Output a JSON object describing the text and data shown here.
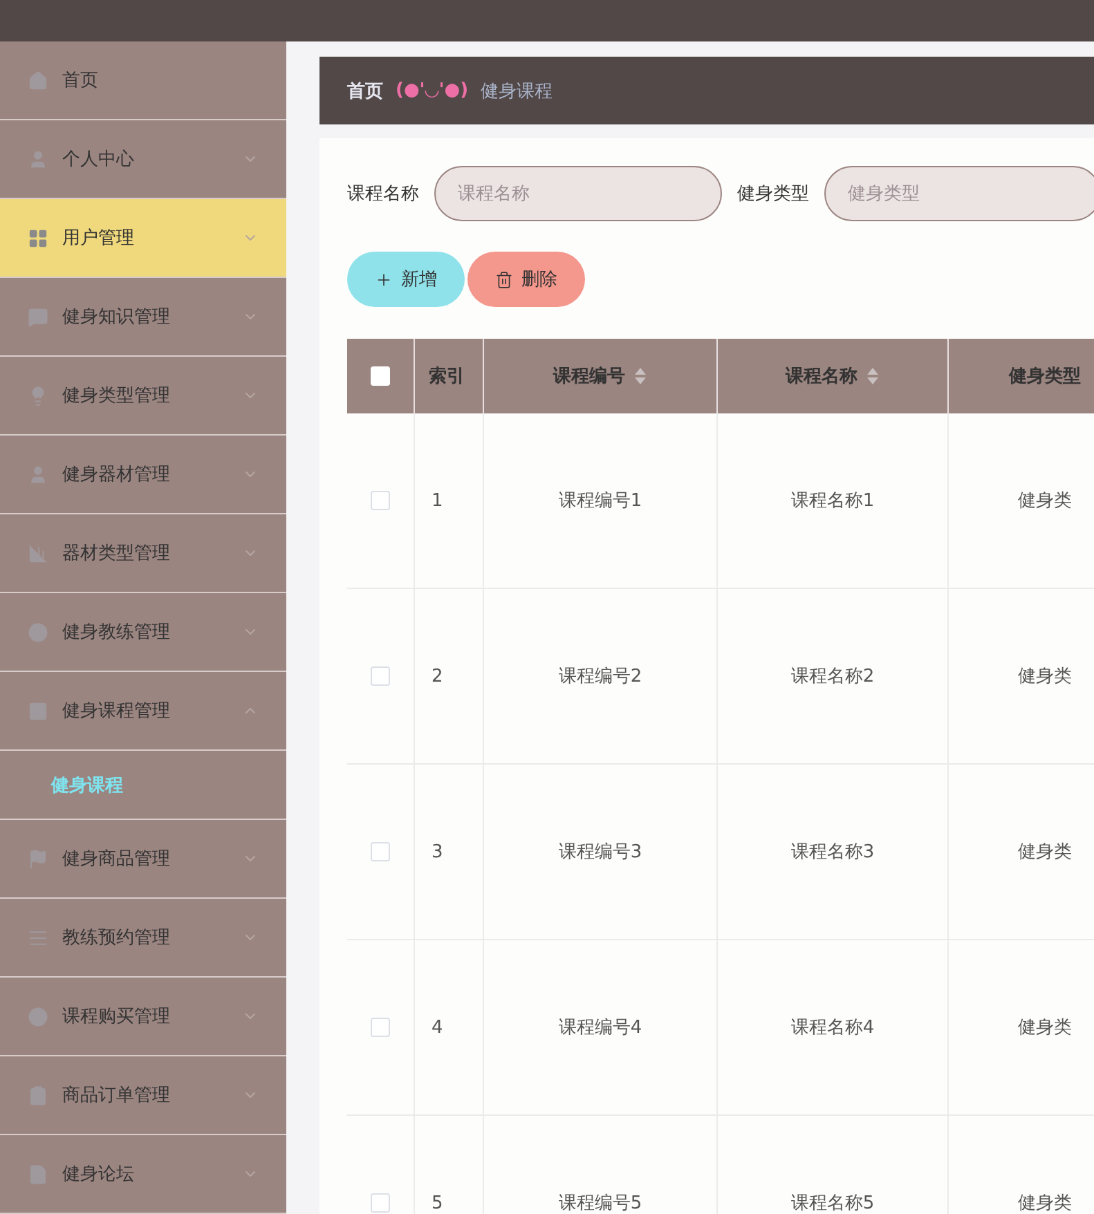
{
  "sidebar": {
    "items": [
      {
        "label": "首页",
        "kind": "link",
        "highlighted": false
      },
      {
        "label": "个人中心",
        "kind": "menu",
        "expanded": false,
        "highlighted": false
      },
      {
        "label": "用户管理",
        "kind": "menu",
        "expanded": false,
        "highlighted": true
      },
      {
        "label": "健身知识管理",
        "kind": "menu",
        "expanded": false,
        "highlighted": false
      },
      {
        "label": "健身类型管理",
        "kind": "menu",
        "expanded": false,
        "highlighted": false
      },
      {
        "label": "健身器材管理",
        "kind": "menu",
        "expanded": false,
        "highlighted": false
      },
      {
        "label": "器材类型管理",
        "kind": "menu",
        "expanded": false,
        "highlighted": false
      },
      {
        "label": "健身教练管理",
        "kind": "menu",
        "expanded": false,
        "highlighted": false
      },
      {
        "label": "健身课程管理",
        "kind": "menu",
        "expanded": true,
        "highlighted": false,
        "children": [
          {
            "label": "健身课程",
            "selected": true
          }
        ]
      },
      {
        "label": "健身商品管理",
        "kind": "menu",
        "expanded": false,
        "highlighted": false
      },
      {
        "label": "教练预约管理",
        "kind": "menu",
        "expanded": false,
        "highlighted": false
      },
      {
        "label": "课程购买管理",
        "kind": "menu",
        "expanded": false,
        "highlighted": false
      },
      {
        "label": "商品订单管理",
        "kind": "menu",
        "expanded": false,
        "highlighted": false
      },
      {
        "label": "健身论坛",
        "kind": "menu",
        "expanded": false,
        "highlighted": false
      }
    ]
  },
  "breadcrumb": {
    "home": "首页",
    "separator": "(●'◡'●)",
    "current": "健身课程"
  },
  "search": {
    "fields": [
      {
        "label": "课程名称",
        "placeholder": "课程名称"
      },
      {
        "label": "健身类型",
        "placeholder": "健身类型"
      }
    ]
  },
  "actions": [
    {
      "label": "新增",
      "kind": "add"
    },
    {
      "label": "删除",
      "kind": "delete"
    }
  ],
  "table": {
    "select_all": {
      "checked": false
    },
    "columns": [
      {
        "label": "索引",
        "sortable": false
      },
      {
        "label": "课程编号",
        "sortable": true
      },
      {
        "label": "课程名称",
        "sortable": true
      },
      {
        "label": "健身类型",
        "sortable": false
      }
    ],
    "rows": [
      {
        "checked": false,
        "cells": [
          "1",
          "课程编号1",
          "课程名称1",
          "健身类"
        ]
      },
      {
        "checked": false,
        "cells": [
          "2",
          "课程编号2",
          "课程名称2",
          "健身类"
        ]
      },
      {
        "checked": false,
        "cells": [
          "3",
          "课程编号3",
          "课程名称3",
          "健身类"
        ]
      },
      {
        "checked": false,
        "cells": [
          "4",
          "课程编号4",
          "课程名称4",
          "健身类"
        ]
      },
      {
        "checked": false,
        "cells": [
          "5",
          "课程编号5",
          "课程名称5",
          "健身类"
        ]
      }
    ]
  }
}
